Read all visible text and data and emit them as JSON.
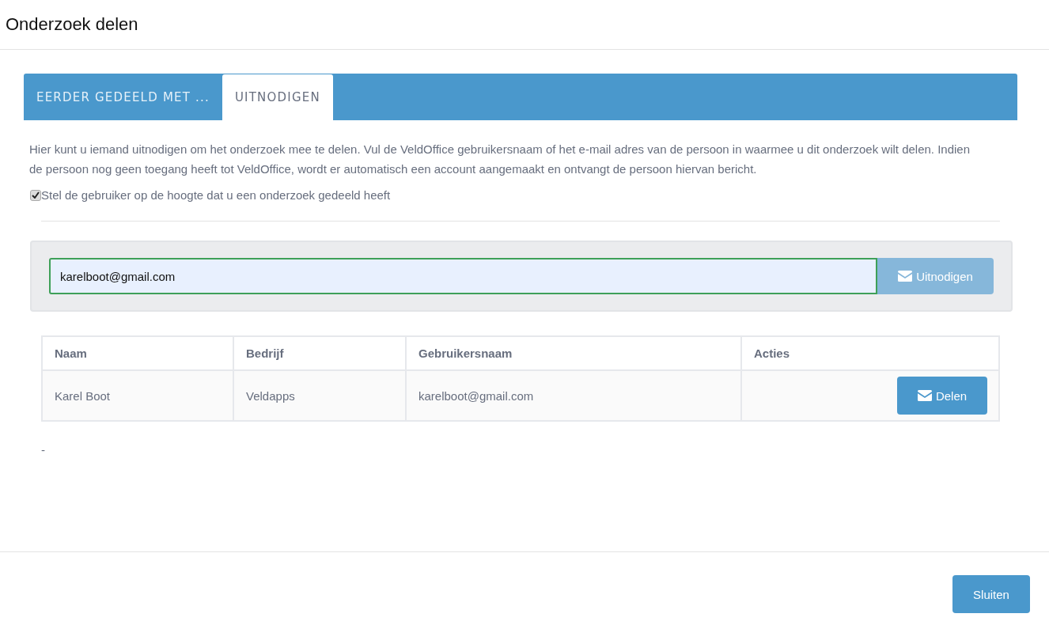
{
  "window": {
    "title": "Onderzoek delen"
  },
  "tabs": [
    {
      "label": "EERDER GEDEELD MET ...",
      "selected": false
    },
    {
      "label": "UITNODIGEN",
      "selected": true
    }
  ],
  "intro": "Hier kunt u iemand uitnodigen om het onderzoek mee te delen. Vul de VeldOffice gebruikersnaam of het e-mail adres van de persoon in waarmee u dit onderzoek wilt delen. Indien de persoon nog geen toegang heeft tot VeldOffice, wordt er automatisch een account aangemaakt en ontvangt de persoon hiervan bericht.",
  "notify": {
    "label": "Stel de gebruiker op de hoogte dat u een onderzoek gedeeld heeft",
    "checked": true
  },
  "invite": {
    "value": "karelboot@gmail.com",
    "button": "Uitnodigen",
    "disabled": true
  },
  "table": {
    "columns": [
      "Naam",
      "Bedrijf",
      "Gebruikersnaam",
      "Acties"
    ],
    "rows": [
      {
        "cells": [
          "Karel Boot",
          "Veldapps",
          "karelboot@gmail.com"
        ],
        "action": "Delen"
      }
    ]
  },
  "note": "-",
  "footer": {
    "button": "Sluiten"
  }
}
